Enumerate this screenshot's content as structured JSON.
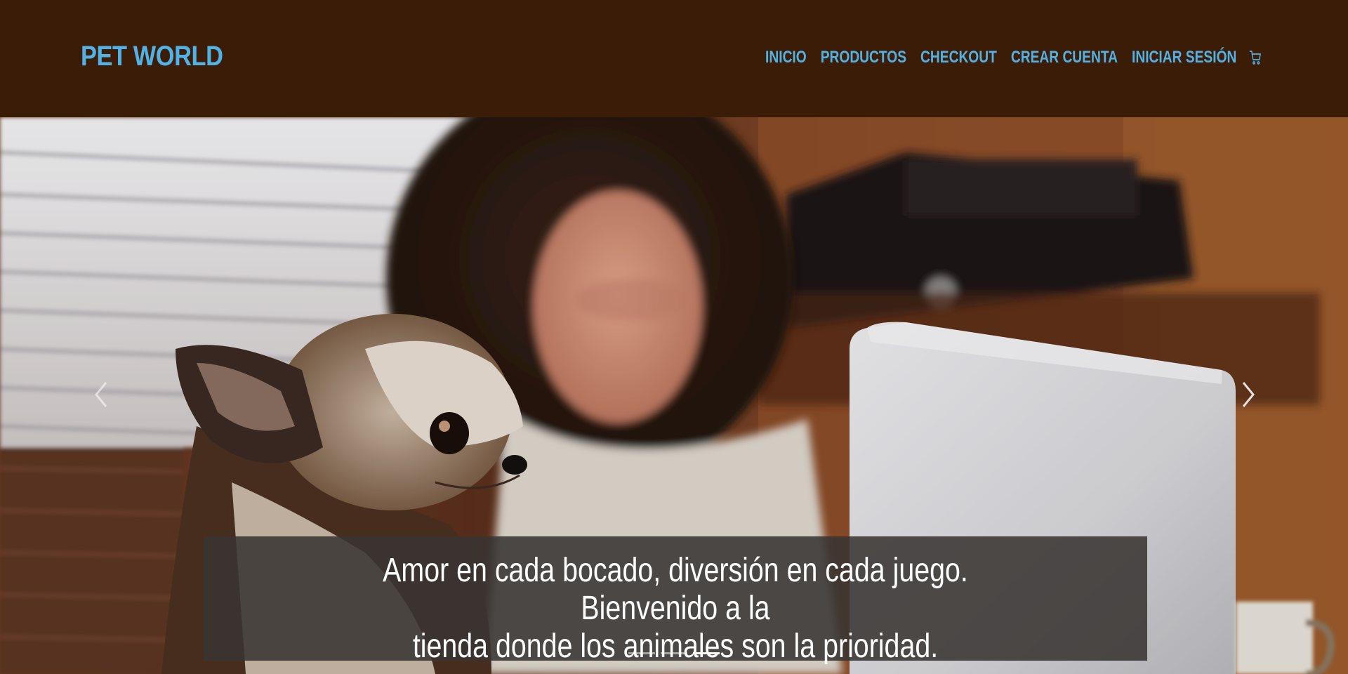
{
  "brand": {
    "name": "PET WORLD"
  },
  "nav": {
    "items": [
      {
        "label": "INICIO"
      },
      {
        "label": "PRODUCTOS"
      },
      {
        "label": "CHECKOUT"
      },
      {
        "label": "CREAR CUENTA"
      },
      {
        "label": "INICIAR SESIÓN"
      }
    ],
    "cart_icon": "shopping-cart-icon"
  },
  "carousel": {
    "caption_line1": "Amor en cada bocado, diversión en cada juego. Bienvenido a la",
    "caption_line2": "tienda donde los animales son la prioridad.",
    "slide_count": 3,
    "active_slide": 3,
    "prev_icon": "chevron-left-icon",
    "next_icon": "chevron-right-icon"
  },
  "colors": {
    "navbar_bg": "#3b1c06",
    "accent": "#52b2e6",
    "caption_bg": "#383432"
  }
}
